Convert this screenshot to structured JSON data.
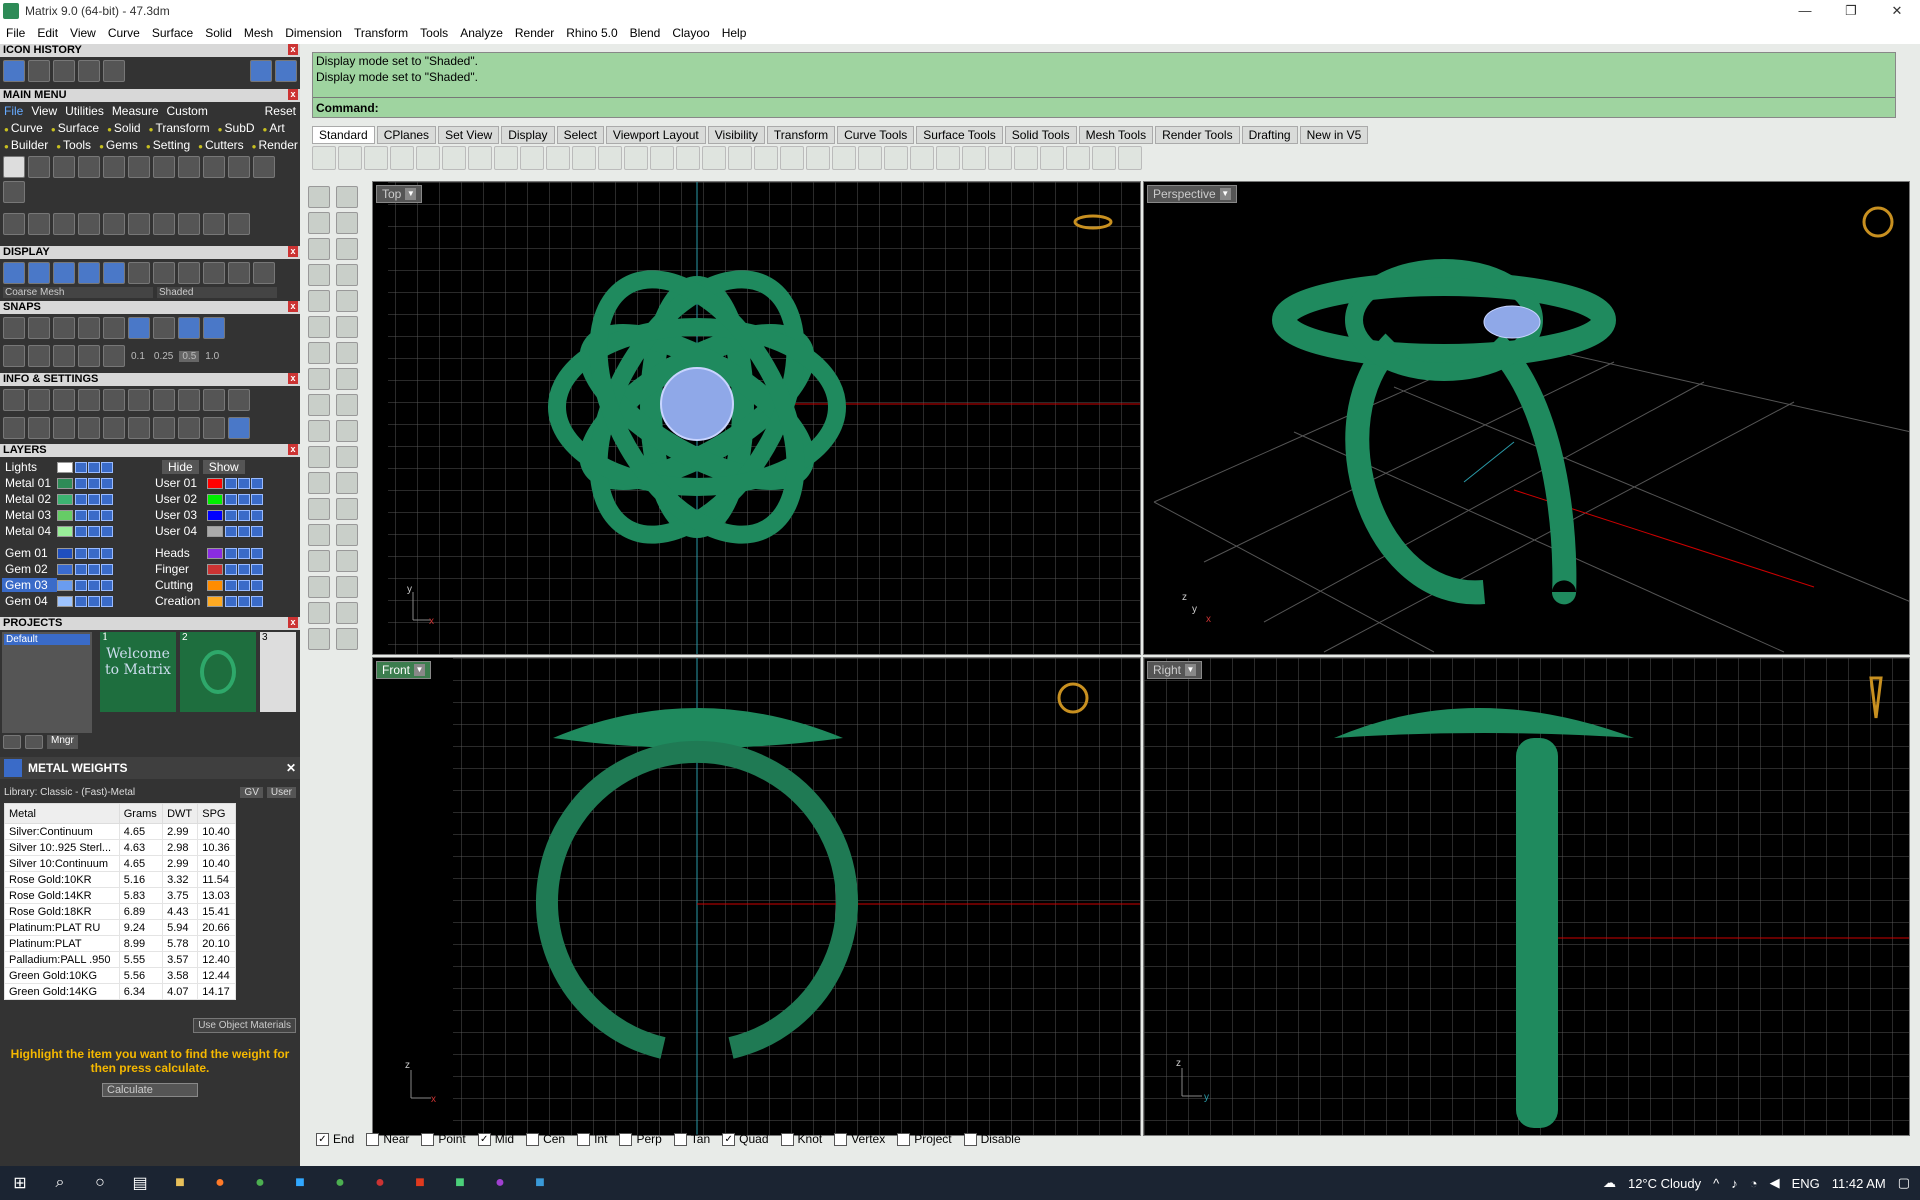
{
  "window": {
    "title": "Matrix 9.0 (64-bit) - 47.3dm",
    "controls": [
      "—",
      "❐",
      "✕"
    ]
  },
  "menubar": [
    "File",
    "Edit",
    "View",
    "Curve",
    "Surface",
    "Solid",
    "Mesh",
    "Dimension",
    "Transform",
    "Tools",
    "Analyze",
    "Render",
    "Rhino 5.0",
    "Blend",
    "Clayoo",
    "Help"
  ],
  "panels": {
    "icon_history": "ICON HISTORY",
    "main_menu": {
      "title": "MAIN MENU",
      "row1": [
        "View",
        "Utilities",
        "Measure",
        "Custom",
        "Reset"
      ],
      "row2": [
        "Curve",
        "Surface",
        "Solid",
        "Transform",
        "SubD",
        "Art"
      ],
      "row3": [
        "Builder",
        "Tools",
        "Gems",
        "Setting",
        "Cutters",
        "Render"
      ]
    },
    "display": {
      "title": "DISPLAY",
      "mesh": "Coarse Mesh",
      "mode": "Shaded"
    },
    "snaps": {
      "title": "SNAPS",
      "values": [
        "0.1",
        "0.25",
        "0.5",
        "1.0"
      ]
    },
    "info": "INFO & SETTINGS",
    "layers": {
      "title": "LAYERS",
      "hide": "Hide",
      "show": "Show",
      "left": [
        {
          "name": "Lights",
          "color": "#ffffff"
        },
        {
          "name": "Metal 01",
          "color": "#2e8b57"
        },
        {
          "name": "Metal 02",
          "color": "#3cb371"
        },
        {
          "name": "Metal 03",
          "color": "#66cc66"
        },
        {
          "name": "Metal 04",
          "color": "#99ee99"
        },
        {
          "name": "Gem 01",
          "color": "#1f4fbf"
        },
        {
          "name": "Gem 02",
          "color": "#3a6bd0"
        },
        {
          "name": "Gem 03",
          "color": "#6a9cf0"
        },
        {
          "name": "Gem 04",
          "color": "#9ec4ff"
        }
      ],
      "right": [
        {
          "name": "",
          "color": ""
        },
        {
          "name": "User 01",
          "color": "#ff0000"
        },
        {
          "name": "User 02",
          "color": "#00ee00"
        },
        {
          "name": "User 03",
          "color": "#0000ff"
        },
        {
          "name": "User 04",
          "color": "#aaaaaa"
        },
        {
          "name": "Heads",
          "color": "#8a2be2"
        },
        {
          "name": "Finger",
          "color": "#cc3333"
        },
        {
          "name": "Cutting",
          "color": "#ff8c00"
        },
        {
          "name": "Creation",
          "color": "#ffaa22"
        }
      ]
    },
    "projects": {
      "title": "PROJECTS",
      "default": "Default",
      "thumbs": [
        "1",
        "2",
        "3"
      ],
      "welcome": "Welcome to Matrix",
      "mngr": "Mngr"
    },
    "metal_weights": {
      "title": "METAL WEIGHTS",
      "library": "Library: Classic - (Fast)-Metal",
      "gv": "GV",
      "user": "User",
      "headers": [
        "Metal",
        "Grams",
        "DWT",
        "SPG"
      ],
      "rows": [
        [
          "Silver:Continuum",
          "4.65",
          "2.99",
          "10.40"
        ],
        [
          "Silver 10:.925 Sterl...",
          "4.63",
          "2.98",
          "10.36"
        ],
        [
          "Silver 10:Continuum",
          "4.65",
          "2.99",
          "10.40"
        ],
        [
          "Rose Gold:10KR",
          "5.16",
          "3.32",
          "11.54"
        ],
        [
          "Rose Gold:14KR",
          "5.83",
          "3.75",
          "13.03"
        ],
        [
          "Rose Gold:18KR",
          "6.89",
          "4.43",
          "15.41"
        ],
        [
          "Platinum:PLAT RU",
          "9.24",
          "5.94",
          "20.66"
        ],
        [
          "Platinum:PLAT",
          "8.99",
          "5.78",
          "20.10"
        ],
        [
          "Palladium:PALL .950",
          "5.55",
          "3.57",
          "12.40"
        ],
        [
          "Green Gold:10KG",
          "5.56",
          "3.58",
          "12.44"
        ],
        [
          "Green Gold:14KG",
          "6.34",
          "4.07",
          "14.17"
        ]
      ],
      "use_object": "Use Object Materials",
      "hint": "Highlight the item you want to find the weight for then press calculate.",
      "calculate": "Calculate"
    }
  },
  "command": {
    "lines": [
      "Display mode set to \"Shaded\".",
      "Display mode set to \"Shaded\"."
    ],
    "prompt": "Command:"
  },
  "tabs": [
    "Standard",
    "CPlanes",
    "Set View",
    "Display",
    "Select",
    "Viewport Layout",
    "Visibility",
    "Transform",
    "Curve Tools",
    "Surface Tools",
    "Solid Tools",
    "Mesh Tools",
    "Render Tools",
    "Drafting",
    "New in V5"
  ],
  "viewports": {
    "top": "Top",
    "perspective": "Perspective",
    "front": "Front",
    "right": "Right"
  },
  "snaps_bar": [
    {
      "label": "End",
      "checked": true
    },
    {
      "label": "Near",
      "checked": false
    },
    {
      "label": "Point",
      "checked": false
    },
    {
      "label": "Mid",
      "checked": true
    },
    {
      "label": "Cen",
      "checked": false
    },
    {
      "label": "Int",
      "checked": false
    },
    {
      "label": "Perp",
      "checked": false
    },
    {
      "label": "Tan",
      "checked": false
    },
    {
      "label": "Quad",
      "checked": true
    },
    {
      "label": "Knot",
      "checked": false
    },
    {
      "label": "Vertex",
      "checked": false
    },
    {
      "label": "Project",
      "checked": false
    },
    {
      "label": "Disable",
      "checked": false
    }
  ],
  "taskbar": {
    "weather": "12°C Cloudy",
    "lang": "ENG",
    "time": "11:42 AM"
  }
}
